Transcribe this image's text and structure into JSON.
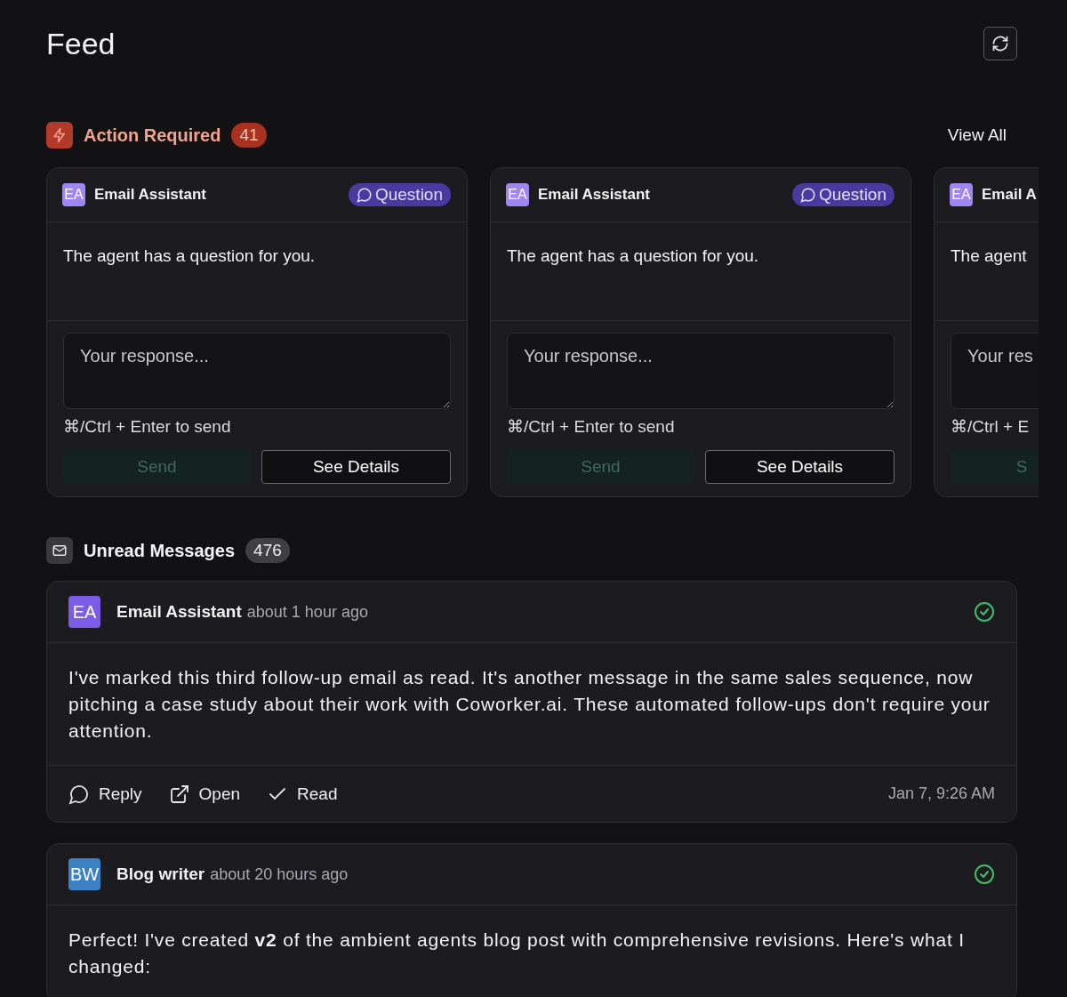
{
  "page": {
    "title": "Feed"
  },
  "action_section": {
    "title": "Action Required",
    "count": "41",
    "view_all": "View All",
    "cards": [
      {
        "initials": "EA",
        "agent": "Email Assistant",
        "tag": "Question",
        "message": "The agent has a question for you.",
        "placeholder": "Your response...",
        "hint": "⌘/Ctrl + Enter to send",
        "send": "Send",
        "send_disabled": true,
        "details": "See Details"
      },
      {
        "initials": "EA",
        "agent": "Email Assistant",
        "tag": "Question",
        "message": "The agent has a question for you.",
        "placeholder": "Your response...",
        "hint": "⌘/Ctrl + Enter to send",
        "send": "Send",
        "send_disabled": true,
        "details": "See Details"
      },
      {
        "initials": "EA",
        "agent": "Email A",
        "message": "The agent",
        "placeholder": "Your res",
        "hint": "⌘/Ctrl + E",
        "send": "S",
        "send_disabled": true
      }
    ]
  },
  "unread_section": {
    "title": "Unread Messages",
    "count": "476",
    "messages": [
      {
        "initials": "EA",
        "color": "#7c5ce6",
        "agent": "Email Assistant",
        "time": "about 1 hour ago",
        "read": true,
        "body": "I've marked this third follow-up email as read. It's another message in the same sales sequence, now pitching a case study about their work with Coworker.ai. These automated follow-ups don't require your attention.",
        "actions": [
          {
            "kind": "reply",
            "label": "Reply"
          },
          {
            "kind": "open",
            "label": "Open"
          },
          {
            "kind": "read",
            "label": "Read"
          }
        ],
        "date": "Jan 7, 9:26 AM"
      },
      {
        "initials": "BW",
        "color": "#3b82c4",
        "agent": "Blog writer",
        "time": "about 20 hours ago",
        "read": true,
        "body": "Perfect! I've created **v2** of the ambient agents blog post with comprehensive revisions. Here's what I changed:"
      }
    ]
  }
}
